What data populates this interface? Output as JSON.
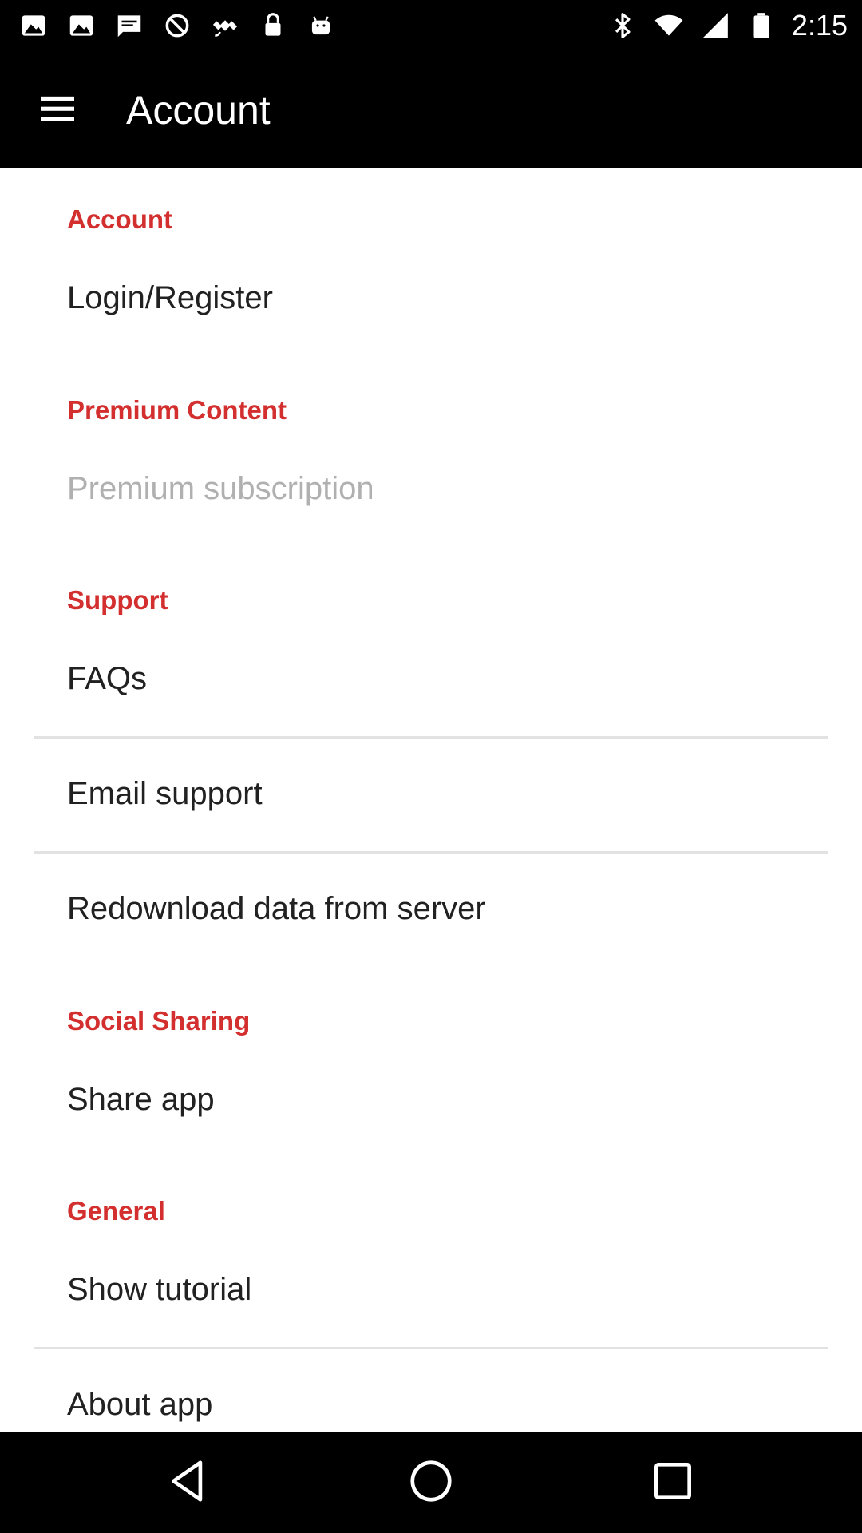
{
  "status_bar": {
    "time": "2:15",
    "icons_left": [
      "image-icon",
      "image-icon",
      "message-icon",
      "do-not-disturb-icon",
      "fake-gps-icon",
      "lock-icon",
      "android-icon"
    ],
    "icons_right": [
      "bluetooth-icon",
      "wifi-icon",
      "signal-icon",
      "battery-icon"
    ]
  },
  "app_bar": {
    "title": "Account",
    "menu_icon": "hamburger-menu-icon"
  },
  "sections": [
    {
      "header": "Account",
      "items": [
        {
          "label": "Login/Register",
          "enabled": true
        }
      ]
    },
    {
      "header": "Premium Content",
      "items": [
        {
          "label": "Premium subscription",
          "enabled": false
        }
      ]
    },
    {
      "header": "Support",
      "items": [
        {
          "label": "FAQs",
          "enabled": true
        },
        {
          "label": "Email support",
          "enabled": true
        },
        {
          "label": "Redownload data from server",
          "enabled": true
        }
      ]
    },
    {
      "header": "Social Sharing",
      "items": [
        {
          "label": "Share app",
          "enabled": true
        }
      ]
    },
    {
      "header": "General",
      "items": [
        {
          "label": "Show tutorial",
          "enabled": true
        },
        {
          "label": "About app",
          "enabled": true
        }
      ]
    }
  ],
  "colors": {
    "app_bar": "#000000",
    "section_header": "#d32f2f",
    "item_text": "#212121",
    "disabled_text": "#b0b0b0",
    "divider": "#e2e2e2"
  },
  "nav_bar": {
    "buttons": [
      "back-icon",
      "home-icon",
      "recents-icon"
    ]
  }
}
